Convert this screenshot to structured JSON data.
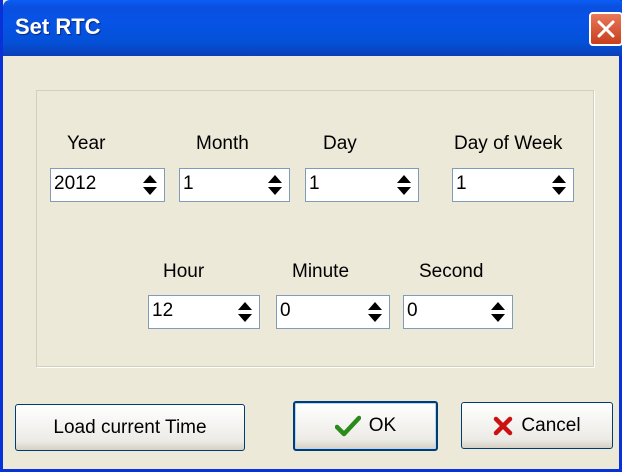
{
  "window": {
    "title": "Set RTC"
  },
  "fields": {
    "year": {
      "label": "Year",
      "value": "2012"
    },
    "month": {
      "label": "Month",
      "value": "1"
    },
    "day": {
      "label": "Day",
      "value": "1"
    },
    "dow": {
      "label": "Day of Week",
      "value": "1"
    },
    "hour": {
      "label": "Hour",
      "value": "12"
    },
    "minute": {
      "label": "Minute",
      "value": "0"
    },
    "second": {
      "label": "Second",
      "value": "0"
    }
  },
  "buttons": {
    "load": "Load current Time",
    "ok": "OK",
    "cancel": "Cancel"
  },
  "icons": {
    "close": "close-icon",
    "ok": "checkmark-icon",
    "cancel": "x-mark-icon",
    "spin": "spin-arrows-icon"
  },
  "colors": {
    "titlebar": "#0a5ef5",
    "dialog_bg": "#ece9d8",
    "close_button": "#c73e1c",
    "ok_check": "#2a8a1a",
    "cancel_x": "#cc1111"
  }
}
